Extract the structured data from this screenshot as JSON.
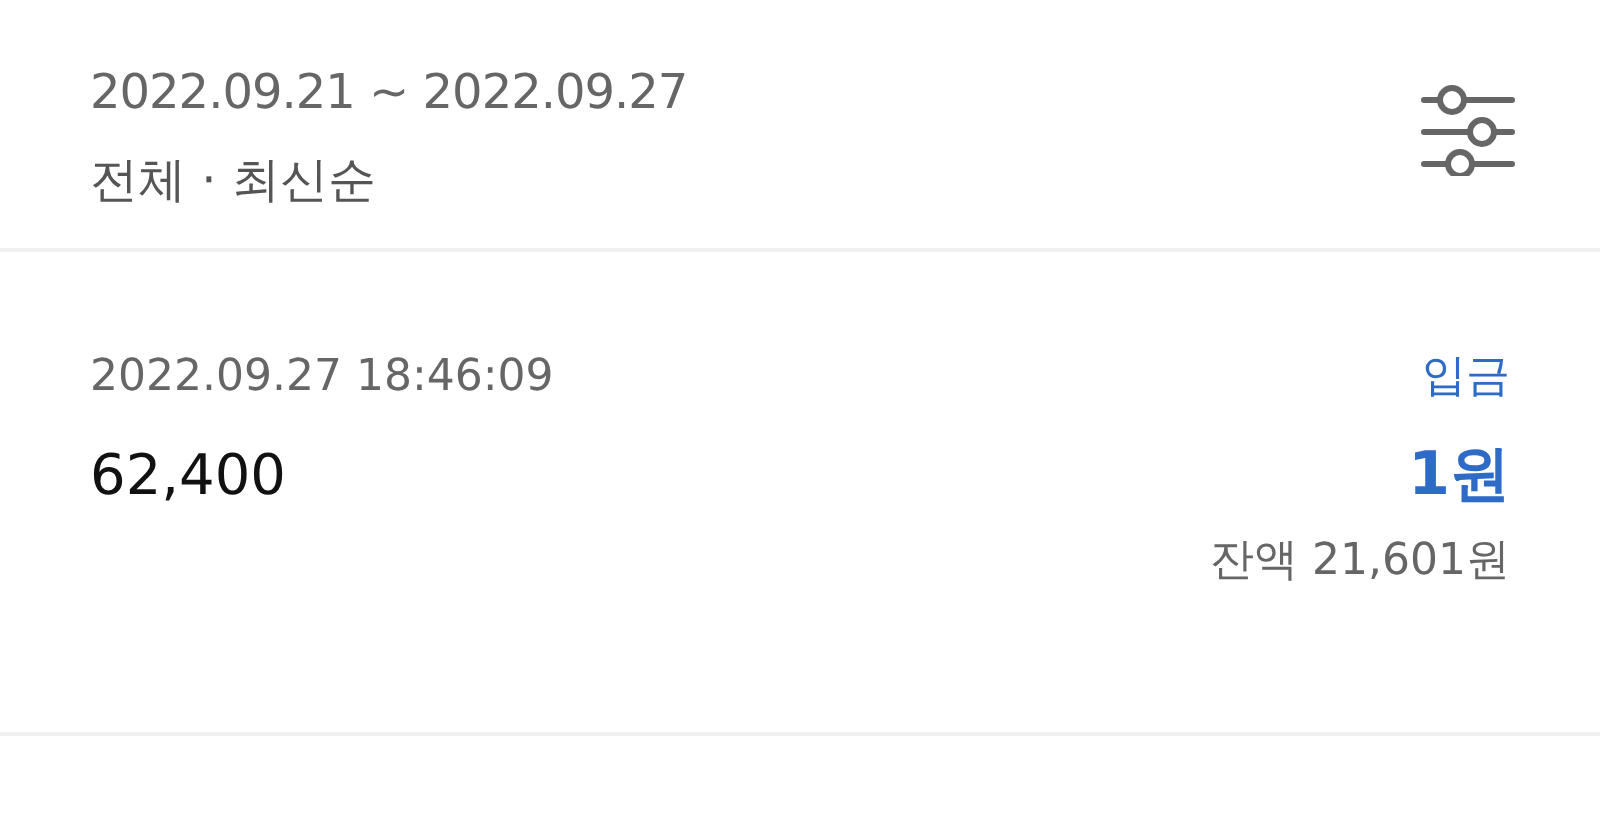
{
  "filter": {
    "period": "2022.09.21 ~ 2022.09.27",
    "summary": "전체 · 최신순"
  },
  "transactions": [
    {
      "time": "2022.09.27 18:46:09",
      "description": "62,400",
      "kind": "deposit",
      "type_label": "입금",
      "amount": "1원",
      "balance": "잔액 21,601원"
    }
  ]
}
